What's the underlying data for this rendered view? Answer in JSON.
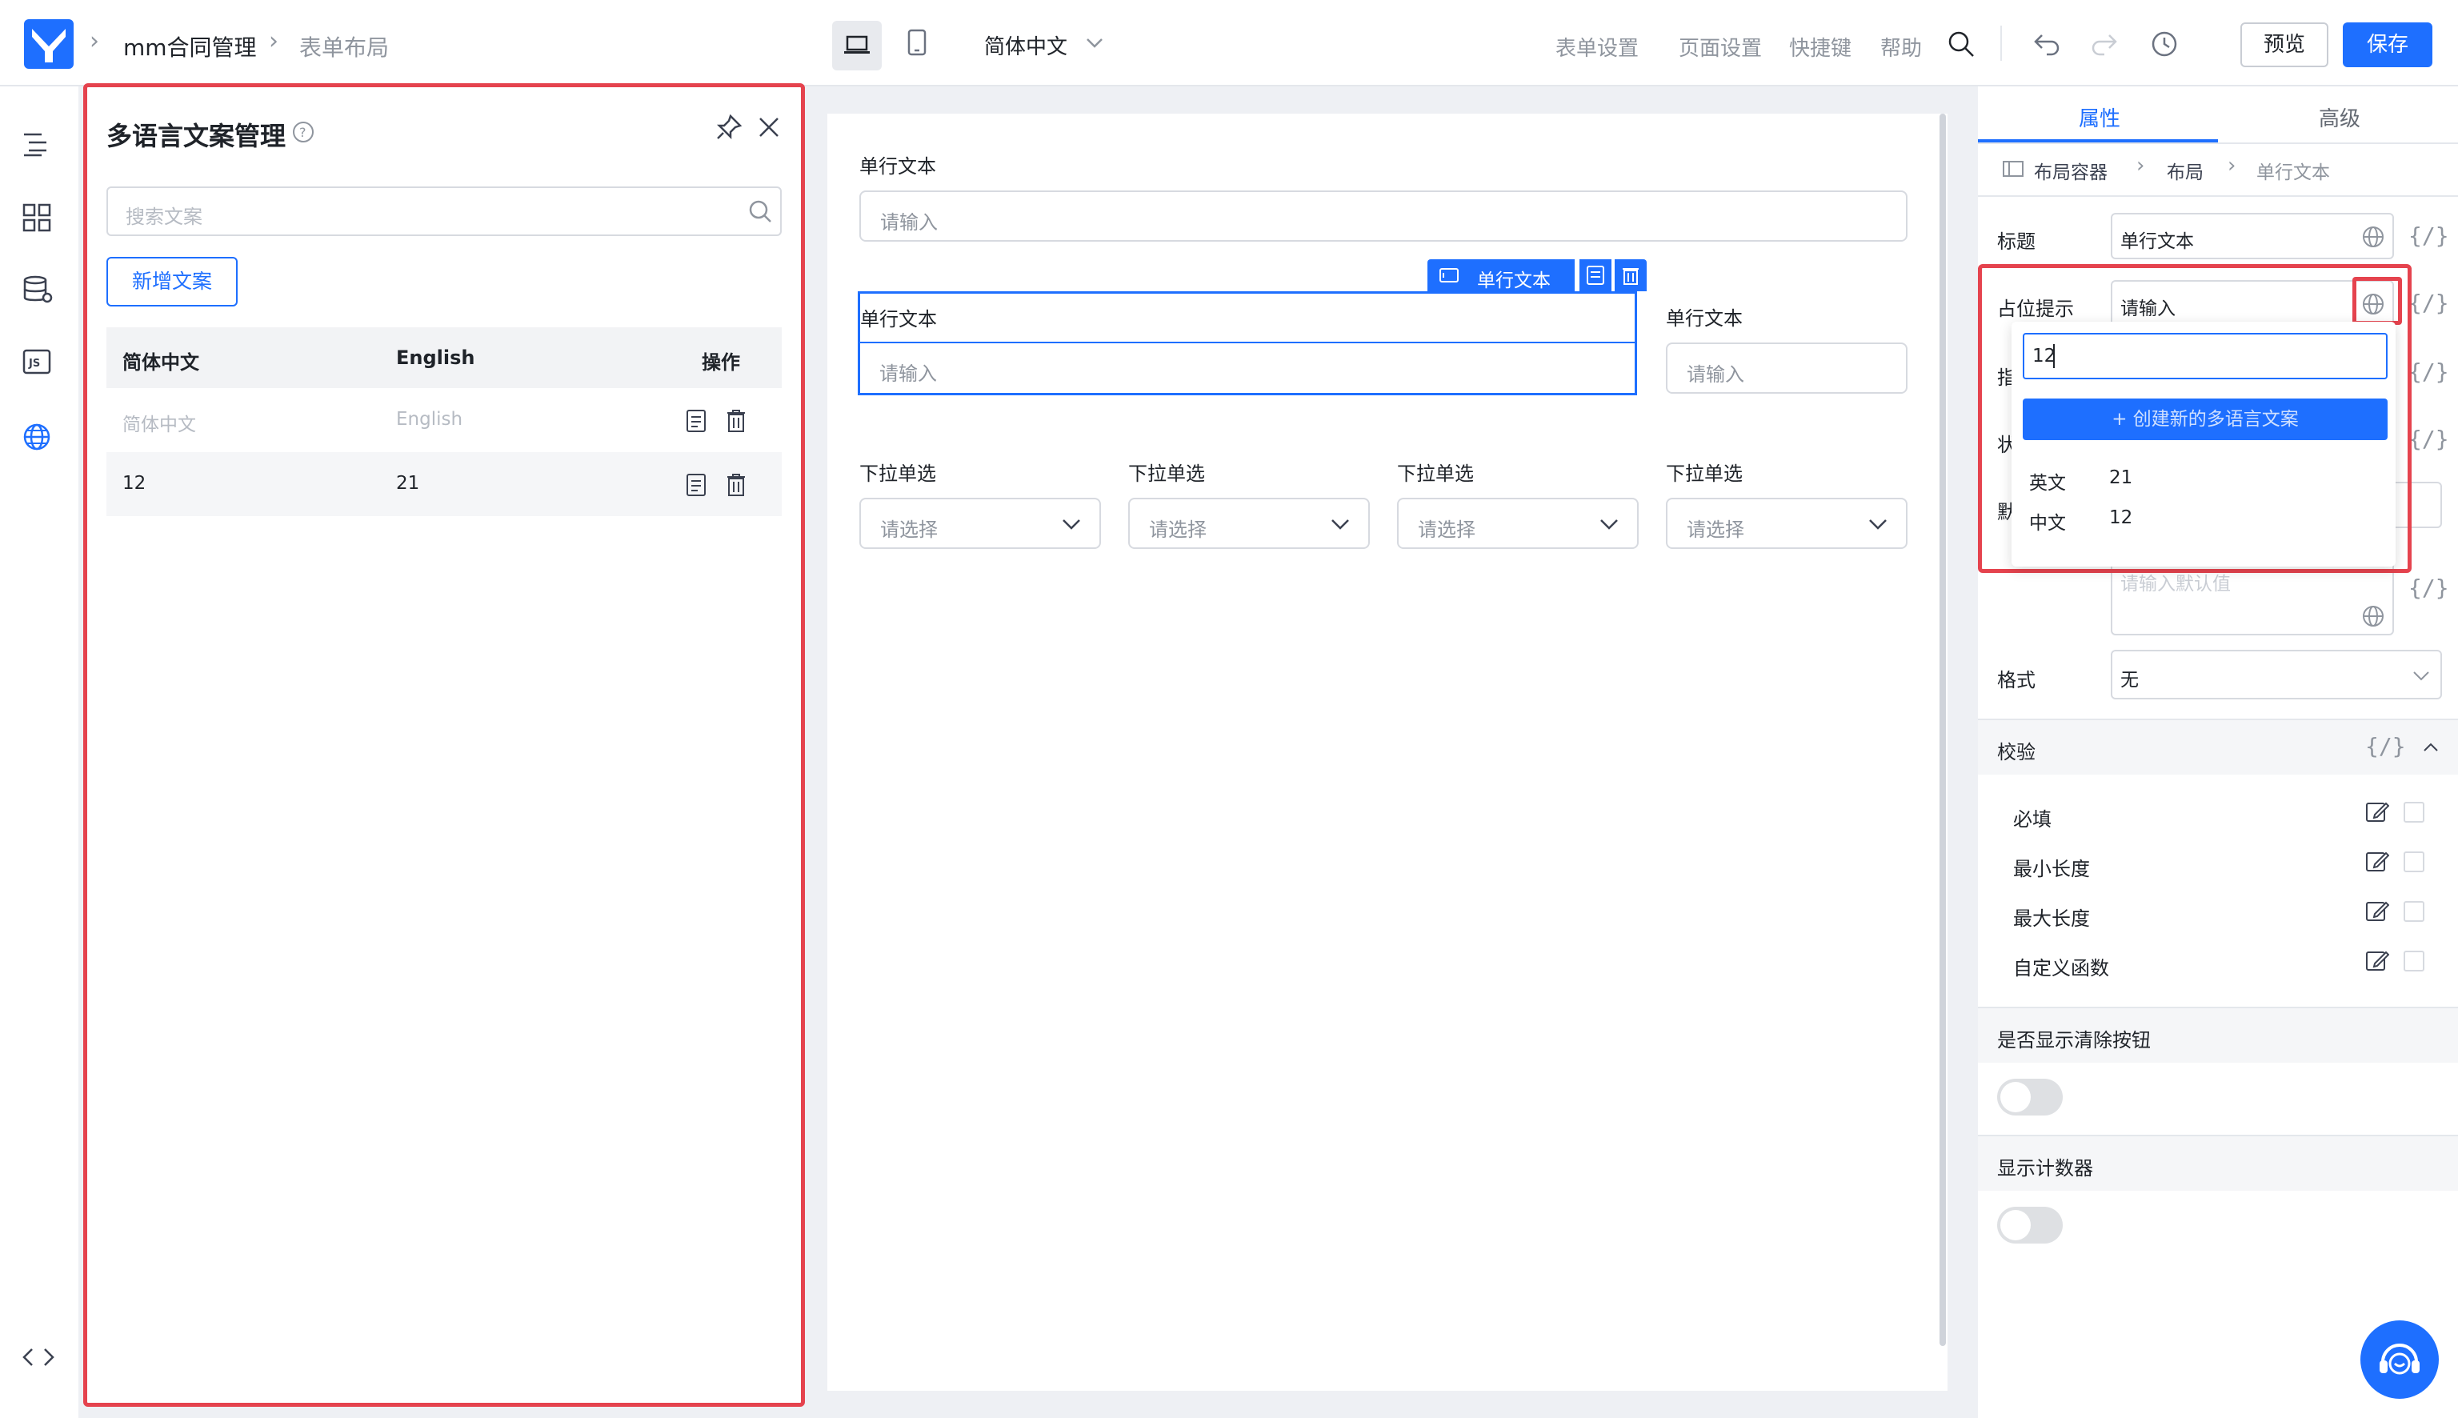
{
  "header": {
    "breadcrumb": [
      "mm合同管理",
      "表单布局"
    ],
    "language": "简体中文",
    "menu": [
      "表单设置",
      "页面设置",
      "快捷键",
      "帮助"
    ],
    "preview": "预览",
    "save": "保存"
  },
  "panel": {
    "title": "多语言文案管理",
    "search_placeholder": "搜索文案",
    "add_button": "新增文案",
    "columns": [
      "简体中文",
      "English",
      "操作"
    ],
    "rows": [
      {
        "zh": "简体中文",
        "en": "English",
        "placeholder": true
      },
      {
        "zh": "12",
        "en": "21",
        "placeholder": false
      }
    ]
  },
  "canvas": {
    "field1_label": "单行文本",
    "field1_placeholder": "请输入",
    "selected_tag": "单行文本",
    "field2_label": "单行文本",
    "field2_placeholder": "请输入",
    "field3_label": "单行文本",
    "field3_placeholder": "请输入",
    "selects": [
      {
        "label": "下拉单选",
        "placeholder": "请选择"
      },
      {
        "label": "下拉单选",
        "placeholder": "请选择"
      },
      {
        "label": "下拉单选",
        "placeholder": "请选择"
      },
      {
        "label": "下拉单选",
        "placeholder": "请选择"
      }
    ]
  },
  "right": {
    "tabs": [
      "属性",
      "高级"
    ],
    "breadcrumb": [
      "布局容器",
      "布局",
      "单行文本"
    ],
    "title_label": "标题",
    "title_value": "单行文本",
    "placeholder_label": "占位提示",
    "placeholder_value": "请输入",
    "hidden_labels": [
      "指",
      "状",
      "默"
    ],
    "ghost_placeholder": "请输入默认值",
    "format_label": "格式",
    "format_value": "无",
    "validation_title": "校验",
    "rules": [
      "必填",
      "最小长度",
      "最大长度",
      "自定义函数"
    ],
    "clear_title": "是否显示清除按钮",
    "counter_title": "显示计数器",
    "brace": "{/}"
  },
  "popover": {
    "input_value": "12",
    "create_button": "+ 创建新的多语言文案",
    "items": [
      {
        "lang": "英文",
        "value": "21"
      },
      {
        "lang": "中文",
        "value": "12"
      }
    ]
  }
}
